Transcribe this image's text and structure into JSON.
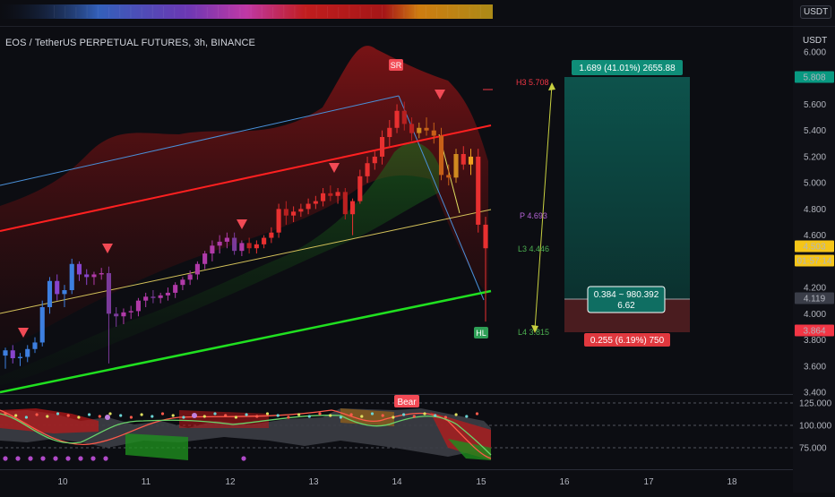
{
  "header": {
    "title": "EOS / TetherUS PERPETUAL FUTURES, 3h, BINANCE",
    "currency_top": "USDT",
    "currency_main": "USDT"
  },
  "chart_data": {
    "type": "candlestick",
    "y_axis": {
      "ticks": [
        "6.000",
        "5.600",
        "5.400",
        "5.200",
        "5.000",
        "4.800",
        "4.600",
        "4.200",
        "4.000",
        "3.800",
        "3.600",
        "3.400"
      ],
      "ylim": [
        3.4,
        6.1
      ]
    },
    "x_axis": {
      "ticks": [
        "10",
        "11",
        "12",
        "13",
        "14",
        "15",
        "16",
        "17",
        "18"
      ]
    },
    "price_tags": [
      {
        "value": "5.808",
        "color": "#089981"
      },
      {
        "value": "4.503",
        "color": "#f5c518"
      },
      {
        "value": "01:57:14",
        "color": "#f5c518"
      },
      {
        "value": "4.119",
        "color": "#3a3d48"
      },
      {
        "value": "3.864",
        "color": "#f23645"
      }
    ],
    "levels": [
      {
        "label": "H3 5.708",
        "color": "#f23645"
      },
      {
        "label": "P 4.693",
        "color": "#b563d6"
      },
      {
        "label": "L3 4.446",
        "color": "#4caf50"
      },
      {
        "label": "L4 3.815",
        "color": "#4caf50"
      }
    ],
    "position": {
      "target_label": "1.689 (41.01%) 2655.88",
      "entry_label_line1": "0.384 ~ 980.392",
      "entry_label_line2": "6.62",
      "stop_label": "0.255 (6.19%) 750"
    },
    "oscillator": {
      "ticks": [
        "125.000",
        "100.000",
        "75.000"
      ],
      "badge": "Bear"
    },
    "markers": {
      "sell_marker_text": "SR",
      "buy_marker_text": "HL"
    },
    "candles": [
      {
        "o": 3.68,
        "h": 3.74,
        "l": 3.58,
        "c": 3.72
      },
      {
        "o": 3.72,
        "h": 3.76,
        "l": 3.62,
        "c": 3.66
      },
      {
        "o": 3.66,
        "h": 3.7,
        "l": 3.6,
        "c": 3.67
      },
      {
        "o": 3.67,
        "h": 3.76,
        "l": 3.63,
        "c": 3.73
      },
      {
        "o": 3.73,
        "h": 3.82,
        "l": 3.7,
        "c": 3.78
      },
      {
        "o": 3.78,
        "h": 4.1,
        "l": 3.75,
        "c": 4.05
      },
      {
        "o": 4.05,
        "h": 4.28,
        "l": 4.0,
        "c": 4.25
      },
      {
        "o": 4.25,
        "h": 4.3,
        "l": 4.1,
        "c": 4.15
      },
      {
        "o": 4.15,
        "h": 4.22,
        "l": 4.05,
        "c": 4.18
      },
      {
        "o": 4.18,
        "h": 4.42,
        "l": 4.15,
        "c": 4.38
      },
      {
        "o": 4.38,
        "h": 4.4,
        "l": 4.25,
        "c": 4.3
      },
      {
        "o": 4.3,
        "h": 4.34,
        "l": 4.22,
        "c": 4.28
      },
      {
        "o": 4.28,
        "h": 4.32,
        "l": 4.22,
        "c": 4.3
      },
      {
        "o": 4.3,
        "h": 4.35,
        "l": 4.26,
        "c": 4.31
      },
      {
        "o": 4.31,
        "h": 4.36,
        "l": 3.62,
        "c": 4.0
      },
      {
        "o": 4.0,
        "h": 4.05,
        "l": 3.9,
        "c": 3.98
      },
      {
        "o": 3.98,
        "h": 4.04,
        "l": 3.92,
        "c": 4.01
      },
      {
        "o": 4.01,
        "h": 4.06,
        "l": 3.96,
        "c": 4.02
      },
      {
        "o": 4.02,
        "h": 4.12,
        "l": 3.98,
        "c": 4.1
      },
      {
        "o": 4.1,
        "h": 4.16,
        "l": 4.05,
        "c": 4.13
      },
      {
        "o": 4.13,
        "h": 4.18,
        "l": 4.08,
        "c": 4.12
      },
      {
        "o": 4.12,
        "h": 4.16,
        "l": 4.08,
        "c": 4.14
      },
      {
        "o": 4.14,
        "h": 4.2,
        "l": 4.1,
        "c": 4.16
      },
      {
        "o": 4.16,
        "h": 4.24,
        "l": 4.12,
        "c": 4.22
      },
      {
        "o": 4.22,
        "h": 4.28,
        "l": 4.18,
        "c": 4.26
      },
      {
        "o": 4.26,
        "h": 4.33,
        "l": 4.22,
        "c": 4.3
      },
      {
        "o": 4.3,
        "h": 4.4,
        "l": 4.26,
        "c": 4.38
      },
      {
        "o": 4.38,
        "h": 4.48,
        "l": 4.34,
        "c": 4.46
      },
      {
        "o": 4.46,
        "h": 4.56,
        "l": 4.4,
        "c": 4.52
      },
      {
        "o": 4.52,
        "h": 4.6,
        "l": 4.46,
        "c": 4.55
      },
      {
        "o": 4.55,
        "h": 4.62,
        "l": 4.5,
        "c": 4.58
      },
      {
        "o": 4.58,
        "h": 4.62,
        "l": 4.45,
        "c": 4.48
      },
      {
        "o": 4.48,
        "h": 4.56,
        "l": 4.44,
        "c": 4.54
      },
      {
        "o": 4.54,
        "h": 4.58,
        "l": 4.46,
        "c": 4.5
      },
      {
        "o": 4.5,
        "h": 4.56,
        "l": 4.46,
        "c": 4.53
      },
      {
        "o": 4.53,
        "h": 4.6,
        "l": 4.5,
        "c": 4.58
      },
      {
        "o": 4.58,
        "h": 4.66,
        "l": 4.54,
        "c": 4.62
      },
      {
        "o": 4.62,
        "h": 4.84,
        "l": 4.58,
        "c": 4.8
      },
      {
        "o": 4.8,
        "h": 4.86,
        "l": 4.68,
        "c": 4.75
      },
      {
        "o": 4.75,
        "h": 4.82,
        "l": 4.7,
        "c": 4.78
      },
      {
        "o": 4.78,
        "h": 4.84,
        "l": 4.74,
        "c": 4.8
      },
      {
        "o": 4.8,
        "h": 4.88,
        "l": 4.76,
        "c": 4.84
      },
      {
        "o": 4.84,
        "h": 4.9,
        "l": 4.8,
        "c": 4.86
      },
      {
        "o": 4.86,
        "h": 4.96,
        "l": 4.82,
        "c": 4.92
      },
      {
        "o": 4.92,
        "h": 4.98,
        "l": 4.86,
        "c": 4.9
      },
      {
        "o": 4.9,
        "h": 4.96,
        "l": 4.84,
        "c": 4.93
      },
      {
        "o": 4.93,
        "h": 4.96,
        "l": 4.72,
        "c": 4.76
      },
      {
        "o": 4.76,
        "h": 4.88,
        "l": 4.6,
        "c": 4.86
      },
      {
        "o": 4.86,
        "h": 5.1,
        "l": 4.84,
        "c": 5.05
      },
      {
        "o": 5.05,
        "h": 5.2,
        "l": 5.0,
        "c": 5.15
      },
      {
        "o": 5.15,
        "h": 5.24,
        "l": 5.1,
        "c": 5.2
      },
      {
        "o": 5.2,
        "h": 5.4,
        "l": 5.14,
        "c": 5.35
      },
      {
        "o": 5.35,
        "h": 5.48,
        "l": 5.28,
        "c": 5.42
      },
      {
        "o": 5.42,
        "h": 5.6,
        "l": 5.38,
        "c": 5.55
      },
      {
        "o": 5.55,
        "h": 5.62,
        "l": 5.4,
        "c": 5.45
      },
      {
        "o": 5.45,
        "h": 5.5,
        "l": 5.32,
        "c": 5.38
      },
      {
        "o": 5.38,
        "h": 5.46,
        "l": 5.34,
        "c": 5.42
      },
      {
        "o": 5.42,
        "h": 5.5,
        "l": 5.36,
        "c": 5.4
      },
      {
        "o": 5.4,
        "h": 5.46,
        "l": 5.3,
        "c": 5.36
      },
      {
        "o": 5.36,
        "h": 5.42,
        "l": 5.02,
        "c": 5.06
      },
      {
        "o": 5.06,
        "h": 5.14,
        "l": 4.98,
        "c": 5.04
      },
      {
        "o": 5.04,
        "h": 5.26,
        "l": 5.0,
        "c": 5.22
      },
      {
        "o": 5.22,
        "h": 5.28,
        "l": 5.1,
        "c": 5.14
      },
      {
        "o": 5.14,
        "h": 5.26,
        "l": 5.06,
        "c": 5.2
      },
      {
        "o": 5.2,
        "h": 5.26,
        "l": 4.62,
        "c": 4.68
      },
      {
        "o": 4.68,
        "h": 4.74,
        "l": 3.94,
        "c": 4.5
      }
    ]
  }
}
